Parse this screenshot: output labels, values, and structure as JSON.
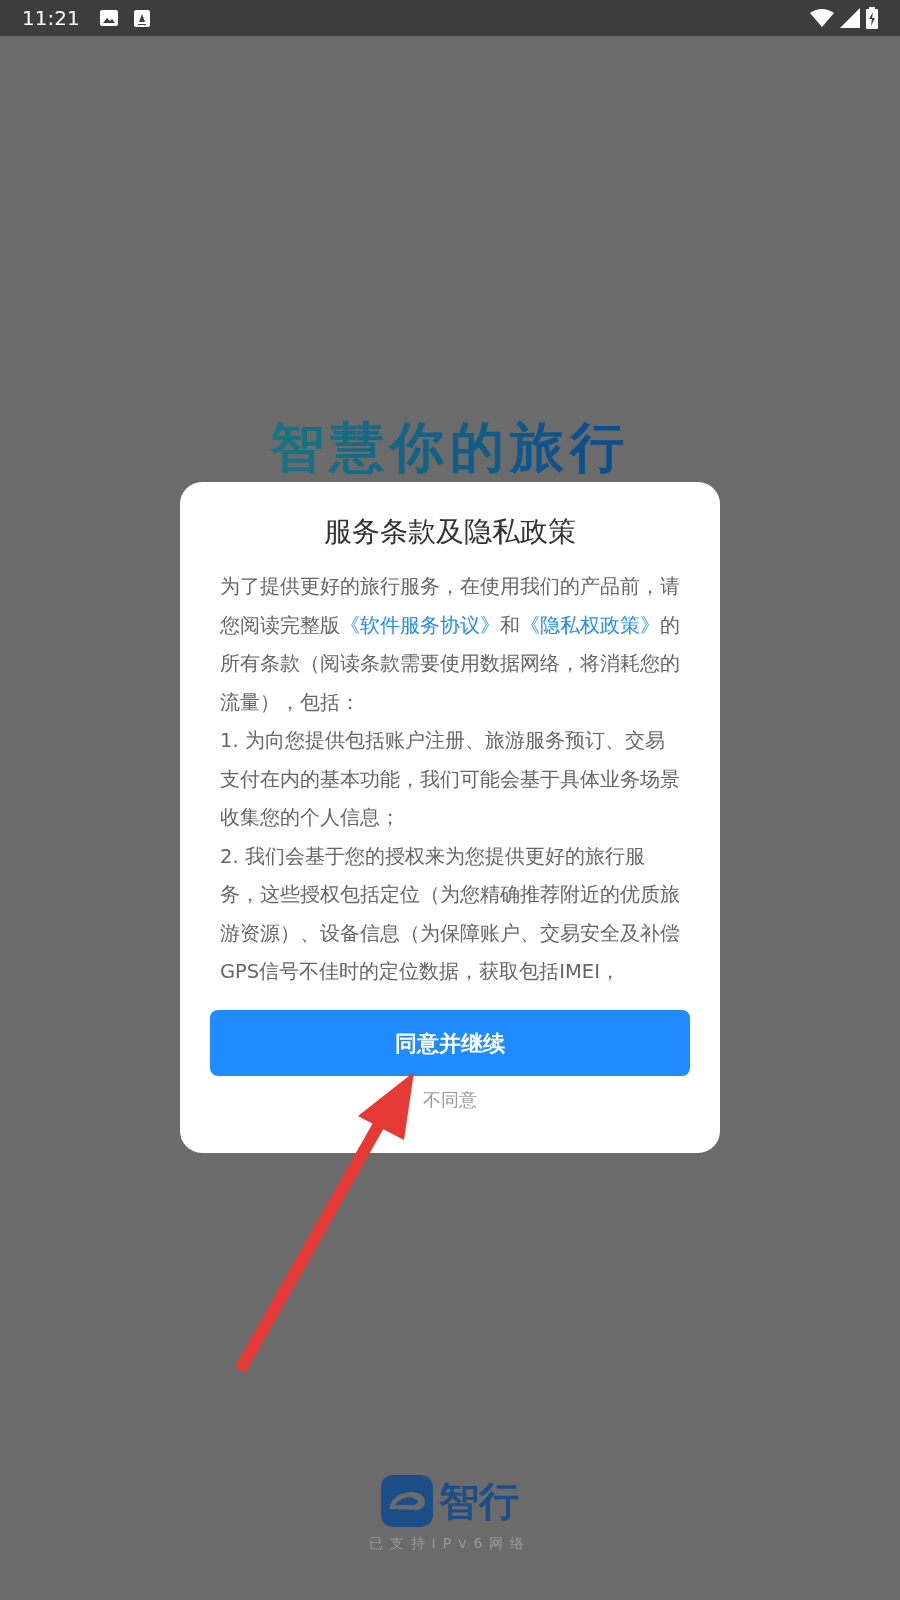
{
  "status_bar": {
    "time": "11:21"
  },
  "background": {
    "slogan": "智慧你的旅行",
    "logo_text": "智行",
    "caption": "已支持IPv6网络"
  },
  "dialog": {
    "title": "服务条款及隐私政策",
    "paragraphs": [
      [
        {
          "kind": "plain",
          "text": "为了提供更好的旅行服务，在使用我们的产品前，请您阅读完整版"
        },
        {
          "kind": "link",
          "text": "《软件服务协议》"
        },
        {
          "kind": "plain",
          "text": "和"
        },
        {
          "kind": "link",
          "text": "《隐私权政策》"
        },
        {
          "kind": "plain",
          "text": "的所有条款（阅读条款需要使用数据网络，将消耗您的流量），包括："
        }
      ],
      [
        {
          "kind": "plain",
          "text": "1. 为向您提供包括账户注册、旅游服务预订、交易支付在内的基本功能，我们可能会基于具体业务场景收集您的个人信息；"
        }
      ],
      [
        {
          "kind": "plain",
          "text": "2. 我们会基于您的授权来为您提供更好的旅行服务，这些授权包括定位（为您精确推荐附近的优质旅游资源）、设备信息（为保障账户、交易安全及补偿GPS信号不佳时的定位数据，获取包括IMEI，"
        }
      ]
    ],
    "primary_button": "同意并继续",
    "secondary_link": "不同意"
  }
}
